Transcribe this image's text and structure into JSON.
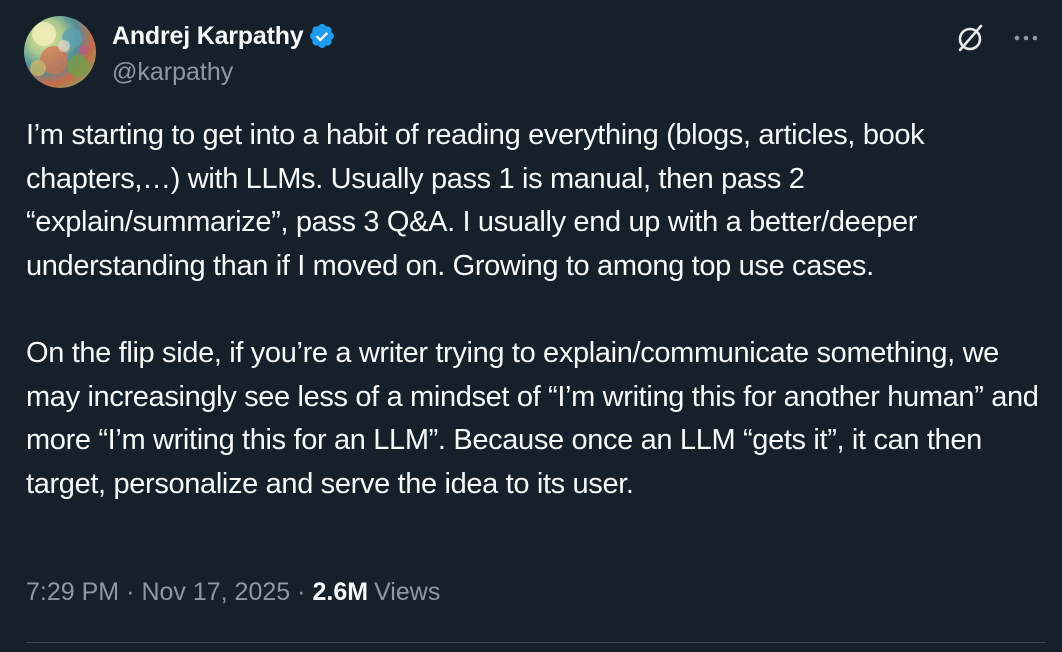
{
  "author": {
    "display_name": "Andrej Karpathy",
    "handle": "@karpathy",
    "verified": true,
    "verified_color": "#1d9bf0"
  },
  "actions": {
    "grok_icon": "grok-icon",
    "more_icon": "more-horizontal-icon"
  },
  "tweet": {
    "paragraphs": [
      "I’m starting to get into a habit of reading everything (blogs, articles, book chapters,…) with LLMs. Usually pass 1 is manual, then pass 2 “explain/summarize”, pass 3 Q&A. I usually end up with a better/deeper understanding than if I moved on. Growing to among top use cases.",
      "On the flip side, if you’re a writer trying to explain/communicate something, we may increasingly see less of a mindset of “I’m writing this for another human” and more “I’m writing this for an LLM”. Because once an LLM “gets it”, it can then target, personalize and serve the idea to its user."
    ]
  },
  "meta": {
    "time": "7:29 PM",
    "separator": "·",
    "date": "Nov 17, 2025",
    "views_count": "2.6M",
    "views_label": "Views"
  },
  "colors": {
    "background": "#15202b",
    "text": "#f7f9f9",
    "secondary_text": "#8b98a5",
    "divider": "#38444d"
  }
}
